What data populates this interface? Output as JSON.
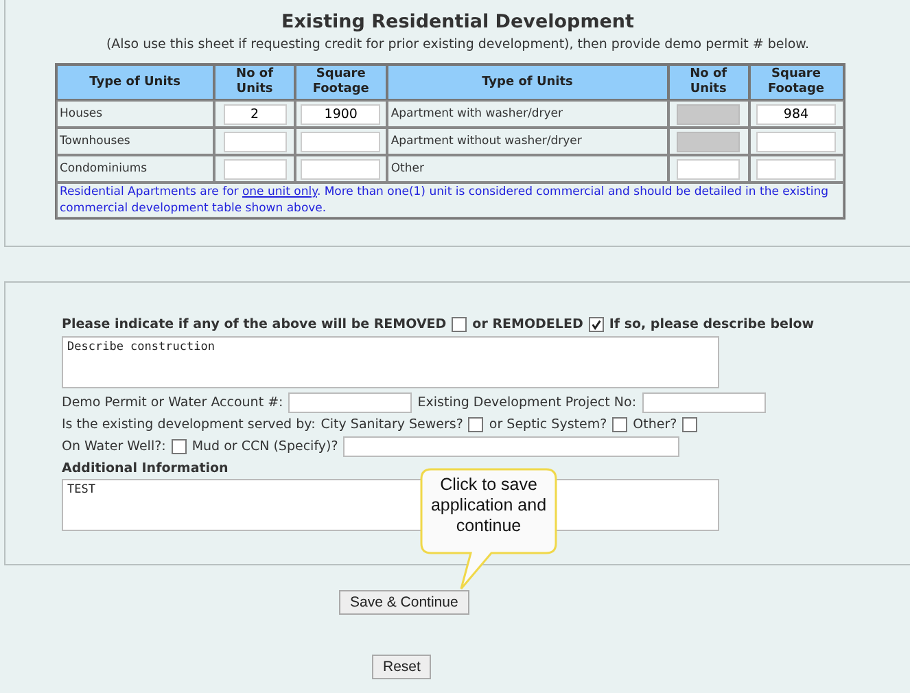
{
  "title": "Existing Residential Development",
  "subtitle": "(Also use this sheet if requesting credit for prior existing development), then provide demo permit # below.",
  "table": {
    "columns": [
      "Type of Units",
      "No of Units",
      "Square Footage",
      "Type of Units",
      "No of Units",
      "Square Footage"
    ],
    "rows": [
      {
        "type": "Houses",
        "units": {
          "value": "2",
          "disabled": false
        },
        "sqft": {
          "value": "1900",
          "disabled": false
        },
        "type2": "Apartment with washer/dryer",
        "units2": {
          "disabled": true
        },
        "sqft2": {
          "value": "984",
          "disabled": false
        }
      },
      {
        "type": "Townhouses",
        "units": {
          "disabled": false
        },
        "sqft": {
          "disabled": false
        },
        "type2": "Apartment without washer/dryer",
        "units2": {
          "disabled": true
        },
        "sqft2": {
          "disabled": false
        }
      },
      {
        "type": "Condominiums",
        "units": {
          "disabled": false
        },
        "sqft": {
          "disabled": false
        },
        "type2": "Other",
        "units2": {
          "disabled": false
        },
        "sqft2": {
          "disabled": false
        }
      }
    ],
    "note_before": "Residential Apartments are for ",
    "note_link": "one unit only",
    "note_after": ". More than one(1) unit is considered commercial and should be detailed in the existing commercial development table shown above."
  },
  "removal": {
    "text": "Please indicate if any of the above will be REMOVED",
    "removed": false,
    "remodeled_label": "or REMODELED",
    "remodeled": true,
    "after": "If so, please describe below"
  },
  "description": {
    "value": "Describe construction"
  },
  "demo_permit": {
    "label": "Demo Permit or Water Account #:"
  },
  "project_no": {
    "label": "Existing Development Project No:"
  },
  "served": {
    "label": "Is the existing development served by:",
    "options": [
      {
        "label": "City Sanitary Sewers?",
        "checked": false
      },
      {
        "label": "or Septic System?",
        "checked": false
      },
      {
        "label": "Other?",
        "checked": false
      }
    ]
  },
  "water_well": {
    "label": "On Water Well?:",
    "checked": false
  },
  "mud": {
    "label": "Mud or CCN (Specify)?"
  },
  "additional": {
    "label": "Additional Information",
    "value": "TEST"
  },
  "tooltip": "Click to save application and continue",
  "buttons": [
    "Save & Continue",
    "Reset"
  ]
}
